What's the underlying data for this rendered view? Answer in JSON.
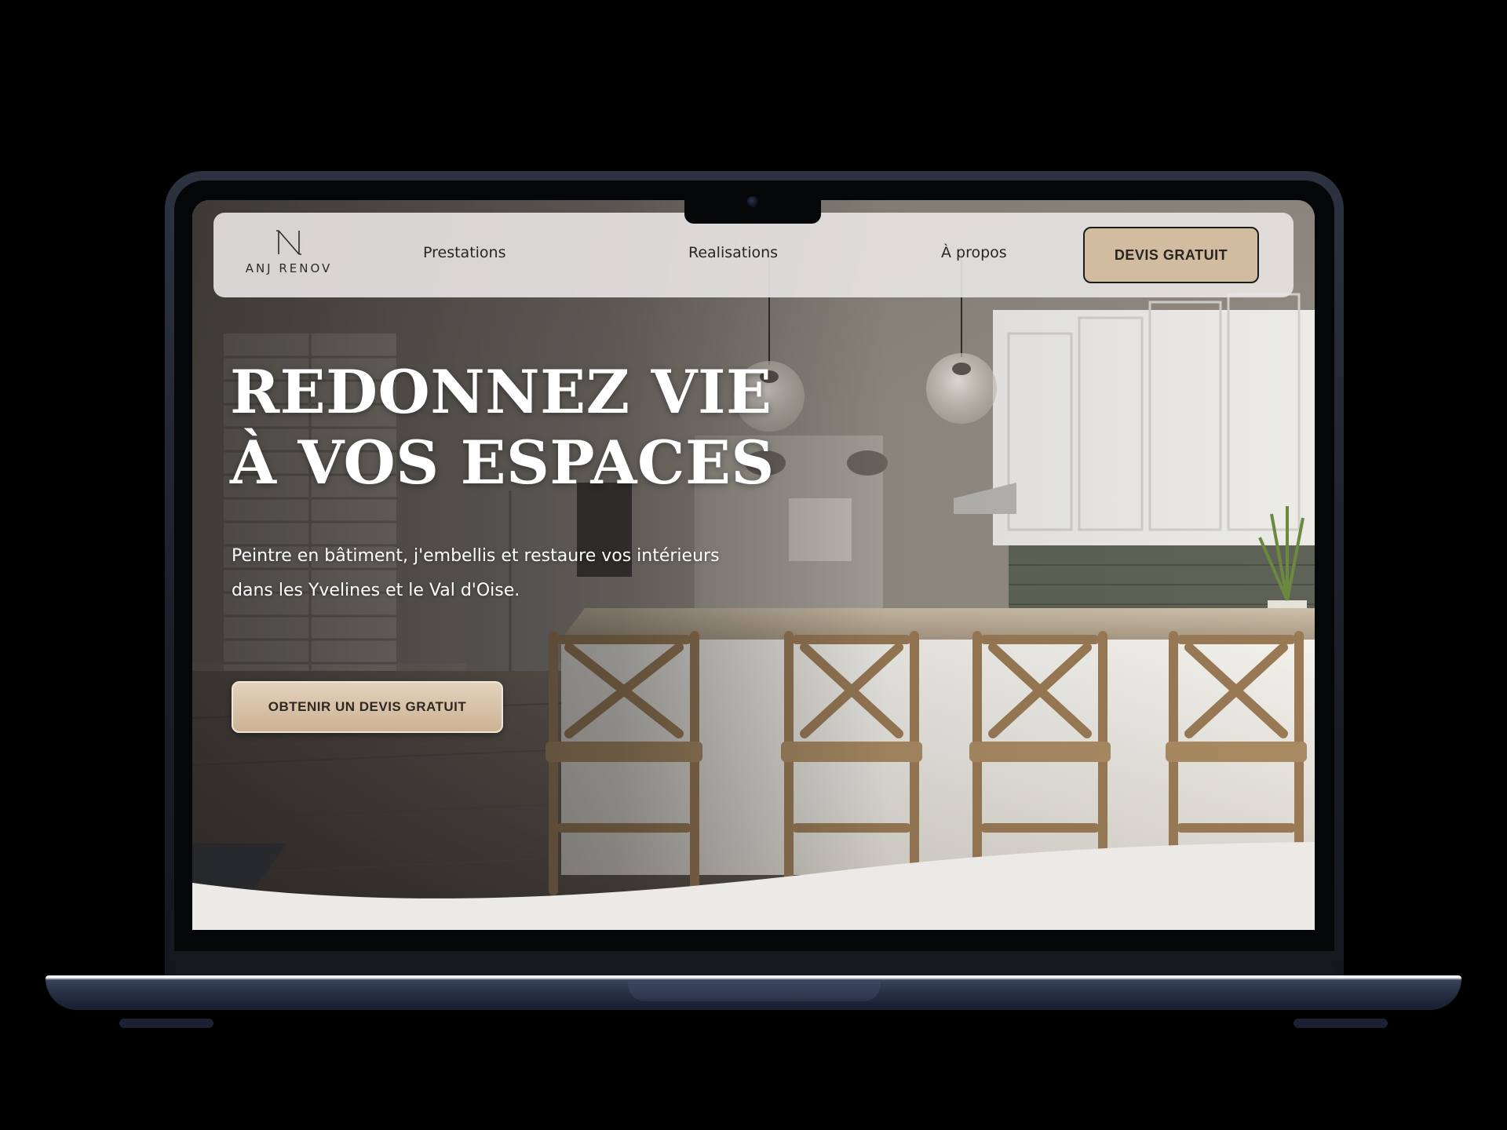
{
  "site": {
    "logo": {
      "icon": "n-monogram-icon",
      "text": "ANJ RENOV"
    },
    "nav": {
      "items": [
        {
          "label": "Prestations"
        },
        {
          "label": "Realisations"
        },
        {
          "label": "À propos"
        }
      ],
      "cta_label": "DEVIS GRATUIT"
    },
    "hero": {
      "title_line1": "REDONNEZ VIE",
      "title_line2": "À VOS ESPACES",
      "subtitle": "Peintre en bâtiment, j'embellis et restaure vos intérieurs dans les Yvelines et le Val d'Oise.",
      "cta_label": "OBTENIR UN DEVIS GRATUIT",
      "background": "kitchen-photo"
    }
  },
  "colors": {
    "accent_beige": "#d2bca0",
    "nav_bg": "#e8e6e4",
    "wave_bg": "#eceae7",
    "text_dark": "#262626",
    "text_light": "#ffffff"
  }
}
